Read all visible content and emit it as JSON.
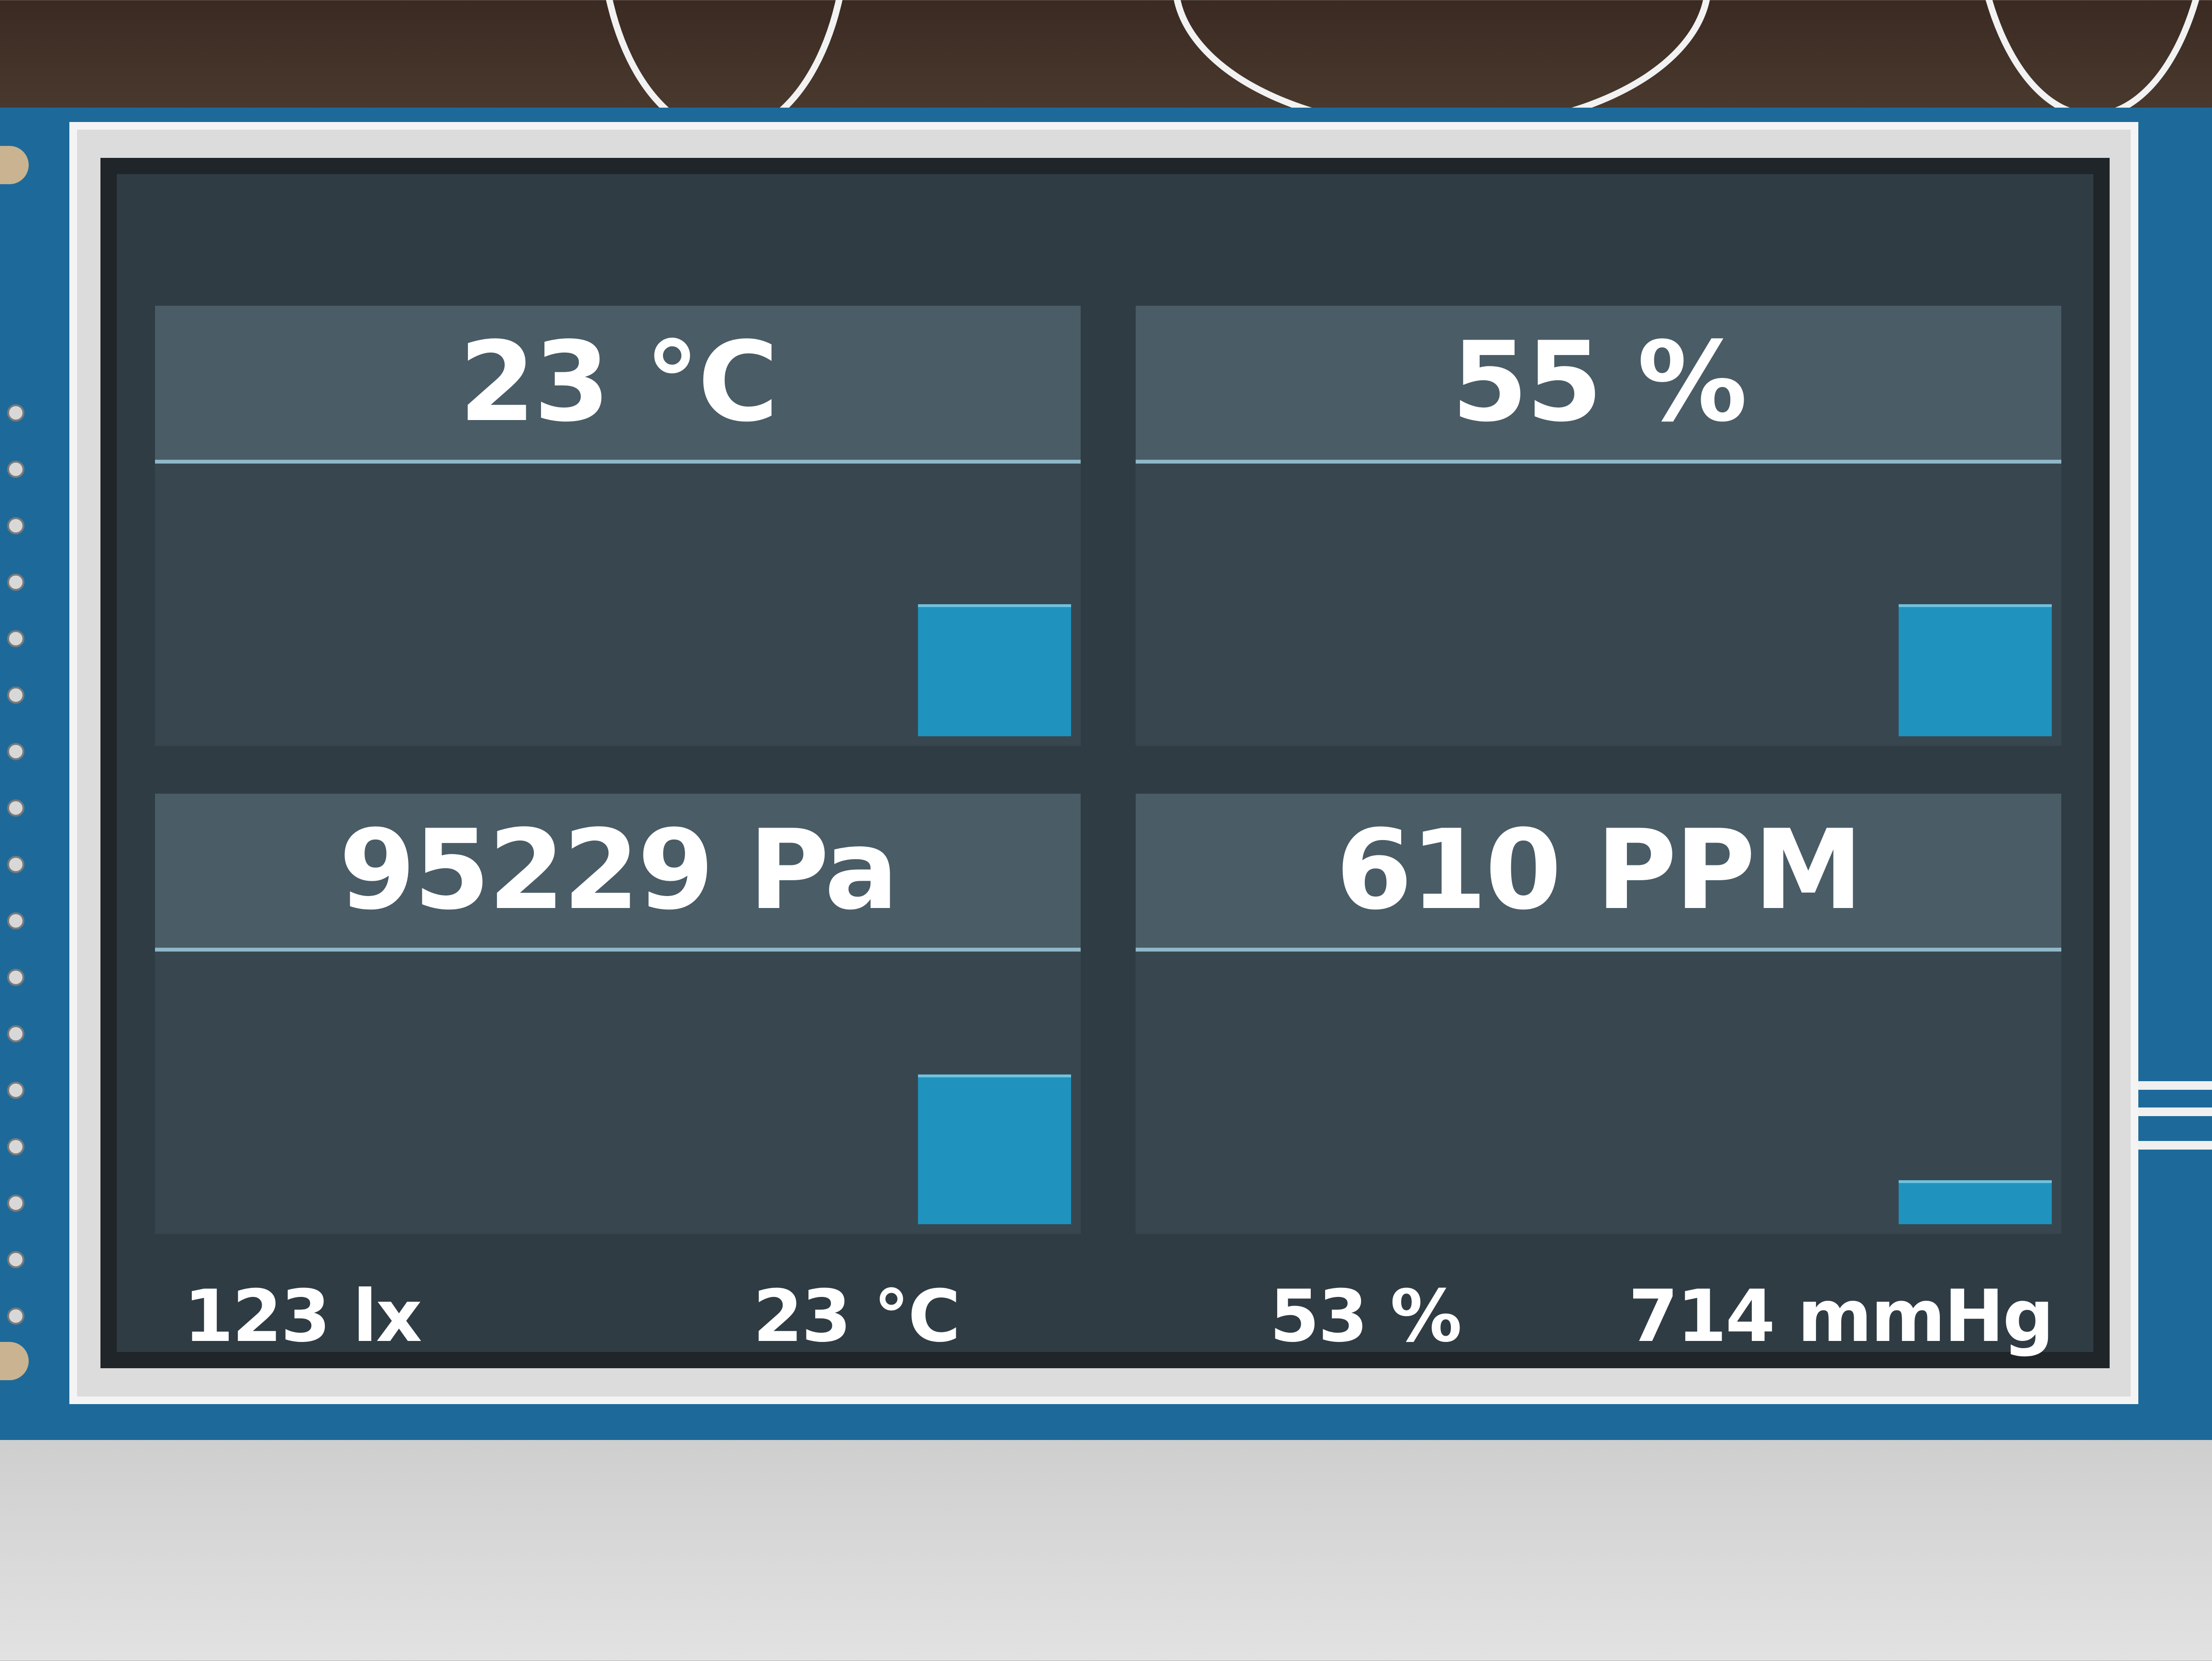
{
  "panels": [
    {
      "label": "23 °C",
      "level": 0.3
    },
    {
      "label": "55 %",
      "level": 0.3
    },
    {
      "label": "95229 Pa",
      "level": 0.34
    },
    {
      "label": "610 PPM",
      "level": 0.1
    }
  ],
  "footer": {
    "light": "123 lx",
    "temperature": "23 °C",
    "humidity": "53 %",
    "pressure": "714 mmHg"
  },
  "colors": {
    "screen_bg": "#2f3c44",
    "panel_bg": "#38474f",
    "header_bg": "#4a5c66",
    "bar": "#1f93bd",
    "pcb": "#1d6a9a",
    "text": "#ffffff"
  }
}
